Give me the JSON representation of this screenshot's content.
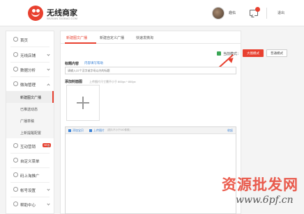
{
  "header": {
    "brand_title": "无线商家",
    "brand_sub": "WUXIAN.TAOBAO.COM",
    "username": "趣佑",
    "logout": "退出"
  },
  "sidebar": {
    "items": [
      {
        "label": "首页"
      },
      {
        "label": "无线店铺"
      },
      {
        "label": "数据分析"
      },
      {
        "label": "微淘管理"
      },
      {
        "label": "互动营销",
        "badge": "NEW"
      },
      {
        "label": "自定义菜单"
      },
      {
        "label": "码上淘推广"
      },
      {
        "label": "帐号设置"
      },
      {
        "label": "帮助中心"
      }
    ],
    "subitems": [
      {
        "label": "新建图文广播"
      },
      {
        "label": "已推送动态"
      },
      {
        "label": "广播草稿"
      },
      {
        "label": "上新提醒配置"
      }
    ]
  },
  "tabs": [
    {
      "label": "新建图文广播"
    },
    {
      "label": "新建自定义广播"
    },
    {
      "label": "快速发微淘"
    }
  ],
  "mode": {
    "label": "当前模式：",
    "big": "大图模式",
    "normal": "普通模式"
  },
  "form": {
    "title_label": "标题内容",
    "title_help": "内容填写帮助",
    "title_placeholder": "请输入22个汉字或字母以内的标题",
    "cover_label": "添加封面图",
    "cover_hint": "上传图片尺寸需不小于 800px * 800px"
  },
  "editor": {
    "add_baby": "添加宝贝",
    "upload_image": "上传图片",
    "image_hint": "(图片不小于640像素)",
    "collapse": "收起"
  },
  "watermark": {
    "main": "资源批发网",
    "sub": "www.6pf.cn"
  },
  "colors": {
    "accent": "#e8402f",
    "link": "#3a82d6"
  }
}
